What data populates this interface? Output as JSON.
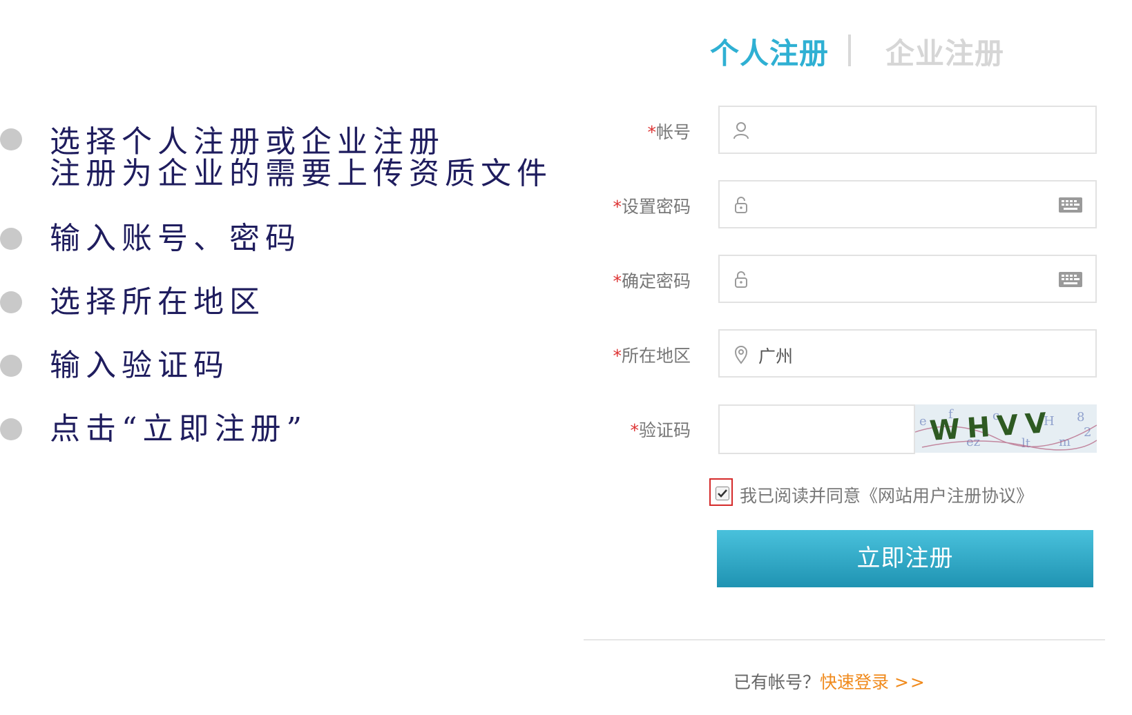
{
  "steps": [
    {
      "lines": [
        "选择个人注册或企业注册",
        "注册为企业的需要上传资质文件"
      ]
    },
    {
      "lines": [
        "输入账号、密码"
      ]
    },
    {
      "lines": [
        "选择所在地区"
      ]
    },
    {
      "lines": [
        "输入验证码"
      ]
    },
    {
      "lines": [
        "点击“立即注册”"
      ]
    }
  ],
  "tabs": {
    "personal": "个人注册",
    "separator": "|",
    "company": "企业注册"
  },
  "form": {
    "required_mark": "*",
    "account": {
      "label": "帐号",
      "value": ""
    },
    "password": {
      "label": "设置密码",
      "value": ""
    },
    "confirm_password": {
      "label": "确定密码",
      "value": ""
    },
    "region": {
      "label": "所在地区",
      "value": "广州"
    },
    "captcha": {
      "label": "验证码",
      "value": "",
      "image_text": "WHVV"
    },
    "agreement": {
      "checked": true,
      "text": "我已阅读并同意《网站用户注册协议》"
    },
    "submit_label": "立即注册"
  },
  "footer": {
    "prefix": "已有帐号？",
    "link": "快速登录",
    "arrow": ">>"
  },
  "colors": {
    "accent": "#2fb0d3",
    "link": "#f08a1c",
    "required": "#d33333",
    "step_text": "#1f1d5e"
  }
}
